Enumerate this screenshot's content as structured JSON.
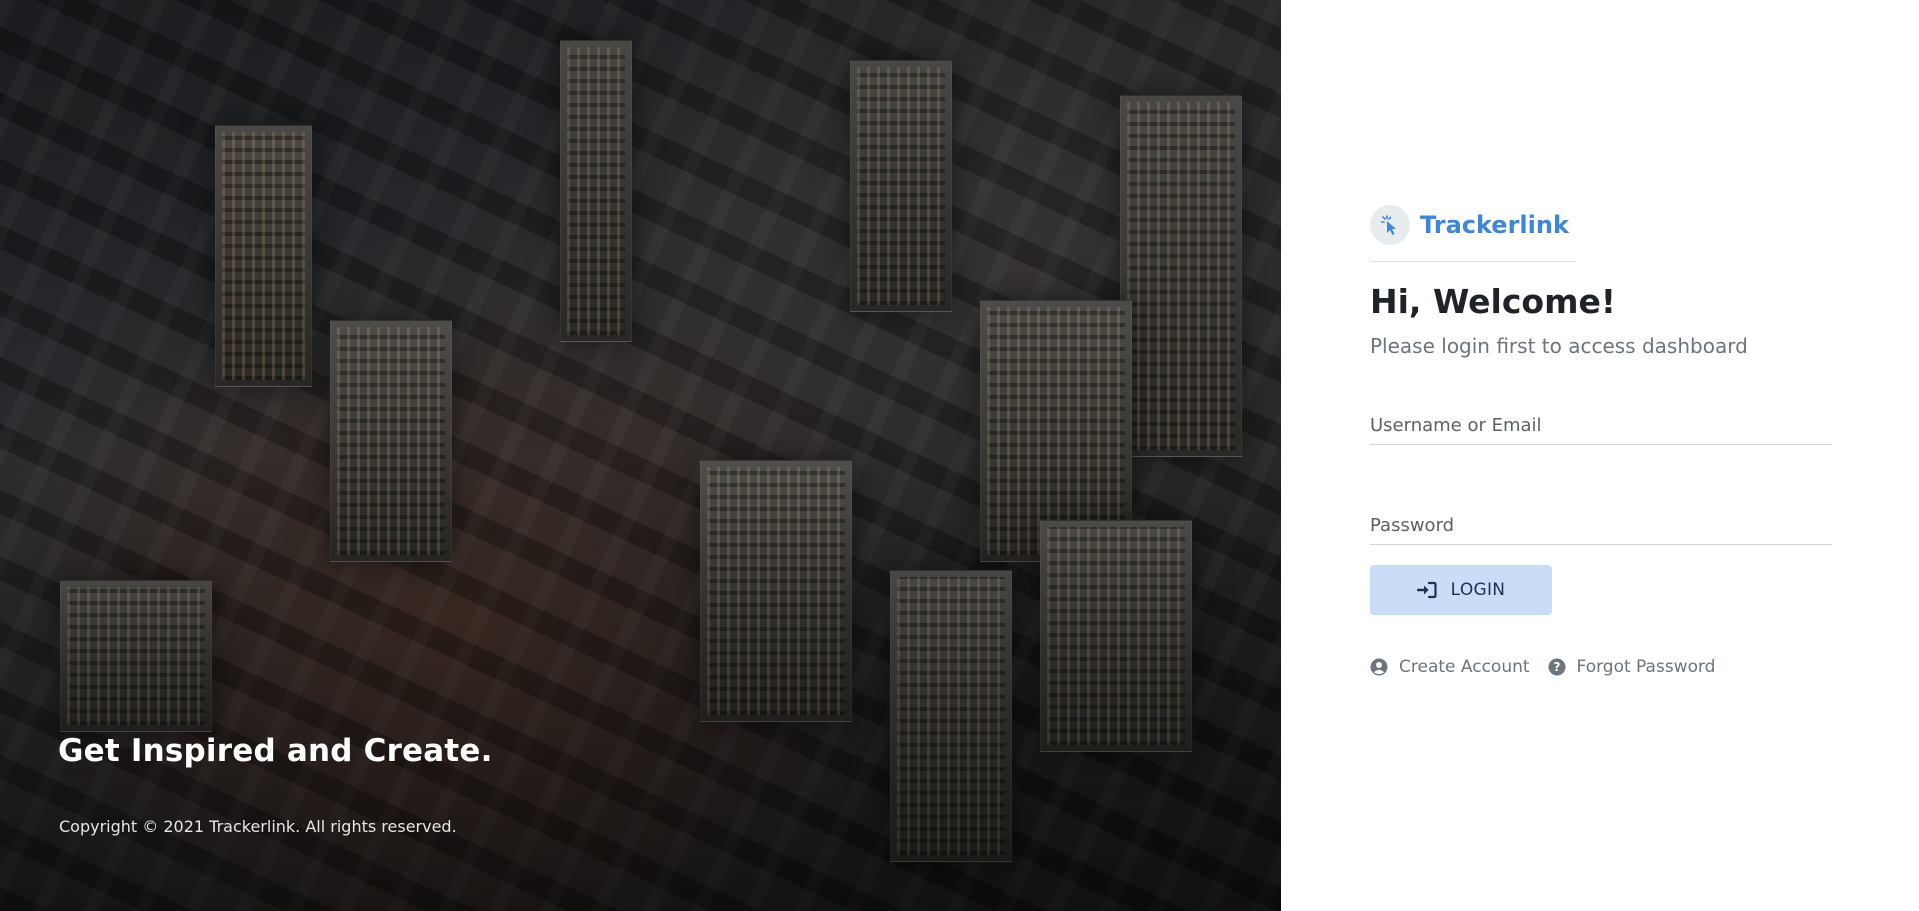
{
  "hero": {
    "tagline": "Get Inspired and Create.",
    "copyright": "Copyright © 2021 Trackerlink. All rights reserved."
  },
  "brand": {
    "name": "Trackerlink",
    "color": "#3d86d8",
    "logo_icon": "cursor-click-icon"
  },
  "login": {
    "title": "Hi, Welcome!",
    "subtitle": "Please login first to access dashboard",
    "username": {
      "placeholder": "Username or Email",
      "value": ""
    },
    "password": {
      "placeholder": "Password",
      "value": ""
    },
    "button": {
      "label": "LOGIN",
      "icon": "sign-in-icon",
      "color": "#c9def6"
    }
  },
  "links": {
    "create_account": {
      "label": "Create Account",
      "icon": "user-circle-icon"
    },
    "forgot_password": {
      "label": "Forgot Password",
      "icon": "question-circle-icon"
    }
  }
}
